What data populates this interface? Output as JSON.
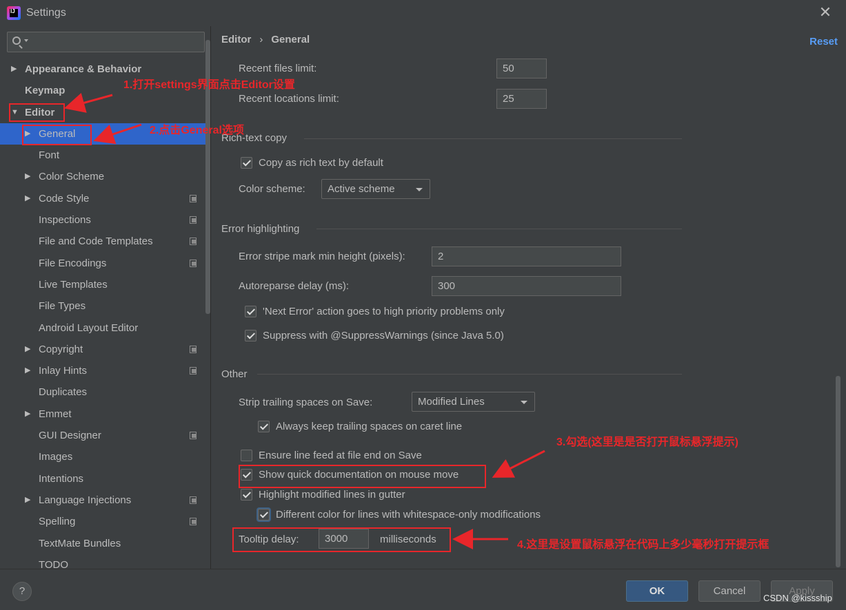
{
  "window": {
    "title": "Settings",
    "icon": "intellij-logo-icon",
    "icon_text": "IJ"
  },
  "search": {
    "placeholder": "",
    "value": ""
  },
  "sidebar": {
    "items": [
      {
        "label": "Appearance & Behavior",
        "level": 0,
        "arrow": "▶",
        "bold": true,
        "copy_icon": false
      },
      {
        "label": "Keymap",
        "level": 0,
        "arrow": "",
        "bold": true,
        "copy_icon": false
      },
      {
        "label": "Editor",
        "level": 0,
        "arrow": "▼",
        "bold": true,
        "copy_icon": false
      },
      {
        "label": "General",
        "level": 1,
        "arrow": "▶",
        "selected": true,
        "copy_icon": false
      },
      {
        "label": "Font",
        "level": 1,
        "arrow": "",
        "copy_icon": false
      },
      {
        "label": "Color Scheme",
        "level": 1,
        "arrow": "▶",
        "copy_icon": false
      },
      {
        "label": "Code Style",
        "level": 1,
        "arrow": "▶",
        "copy_icon": true
      },
      {
        "label": "Inspections",
        "level": 1,
        "arrow": "",
        "copy_icon": true
      },
      {
        "label": "File and Code Templates",
        "level": 1,
        "arrow": "",
        "copy_icon": true
      },
      {
        "label": "File Encodings",
        "level": 1,
        "arrow": "",
        "copy_icon": true
      },
      {
        "label": "Live Templates",
        "level": 1,
        "arrow": "",
        "copy_icon": false
      },
      {
        "label": "File Types",
        "level": 1,
        "arrow": "",
        "copy_icon": false
      },
      {
        "label": "Android Layout Editor",
        "level": 1,
        "arrow": "",
        "copy_icon": false
      },
      {
        "label": "Copyright",
        "level": 1,
        "arrow": "▶",
        "copy_icon": true
      },
      {
        "label": "Inlay Hints",
        "level": 1,
        "arrow": "▶",
        "copy_icon": true
      },
      {
        "label": "Duplicates",
        "level": 1,
        "arrow": "",
        "copy_icon": false
      },
      {
        "label": "Emmet",
        "level": 1,
        "arrow": "▶",
        "copy_icon": false
      },
      {
        "label": "GUI Designer",
        "level": 1,
        "arrow": "",
        "copy_icon": true
      },
      {
        "label": "Images",
        "level": 1,
        "arrow": "",
        "copy_icon": false
      },
      {
        "label": "Intentions",
        "level": 1,
        "arrow": "",
        "copy_icon": false
      },
      {
        "label": "Language Injections",
        "level": 1,
        "arrow": "▶",
        "copy_icon": true
      },
      {
        "label": "Spelling",
        "level": 1,
        "arrow": "",
        "copy_icon": true
      },
      {
        "label": "TextMate Bundles",
        "level": 1,
        "arrow": "",
        "copy_icon": false
      },
      {
        "label": "TODO",
        "level": 1,
        "arrow": "",
        "copy_icon": false
      }
    ]
  },
  "breadcrumb": {
    "parent": "Editor",
    "separator": "›",
    "current": "General"
  },
  "reset_label": "Reset",
  "recent": {
    "files_label": "Recent files limit:",
    "files_value": "50",
    "locations_label": "Recent locations limit:",
    "locations_value": "25"
  },
  "rich_text": {
    "section": "Rich-text copy",
    "copy_label": "Copy as rich text by default",
    "scheme_label": "Color scheme:",
    "scheme_value": "Active scheme"
  },
  "error_highlighting": {
    "section": "Error highlighting",
    "stripe_label": "Error stripe mark min height (pixels):",
    "stripe_value": "2",
    "autoreparse_label": "Autoreparse delay (ms):",
    "autoreparse_value": "300",
    "next_error_label": "'Next Error' action goes to high priority problems only",
    "suppress_label": "Suppress with @SuppressWarnings (since Java 5.0)"
  },
  "other": {
    "section": "Other",
    "strip_label": "Strip trailing spaces on Save:",
    "strip_value": "Modified Lines",
    "keep_trailing_label": "Always keep trailing spaces on caret line",
    "ensure_lf_label": "Ensure line feed at file end on Save",
    "quick_doc_label": "Show quick documentation on mouse move",
    "highlight_modified_label": "Highlight modified lines in gutter",
    "different_color_label": "Different color for lines with whitespace-only modifications",
    "tooltip_label": "Tooltip delay:",
    "tooltip_value": "3000",
    "tooltip_unit": "milliseconds"
  },
  "footer": {
    "help": "?",
    "ok": "OK",
    "cancel": "Cancel",
    "apply": "Apply"
  },
  "watermark": "CSDN @kissship",
  "annotations": {
    "step1": "1.打开settings界面点击Editor设置",
    "step2": "2.点击General选项",
    "step3": "3.勾选(这里是是否打开鼠标悬浮提示)",
    "step4": "4.这里是设置鼠标悬浮在代码上多少毫秒打开提示框"
  },
  "colors": {
    "background": "#3c3f41",
    "selection": "#2f65ca",
    "link": "#589df6",
    "annotation": "#e8262a",
    "ok_button": "#365880"
  }
}
